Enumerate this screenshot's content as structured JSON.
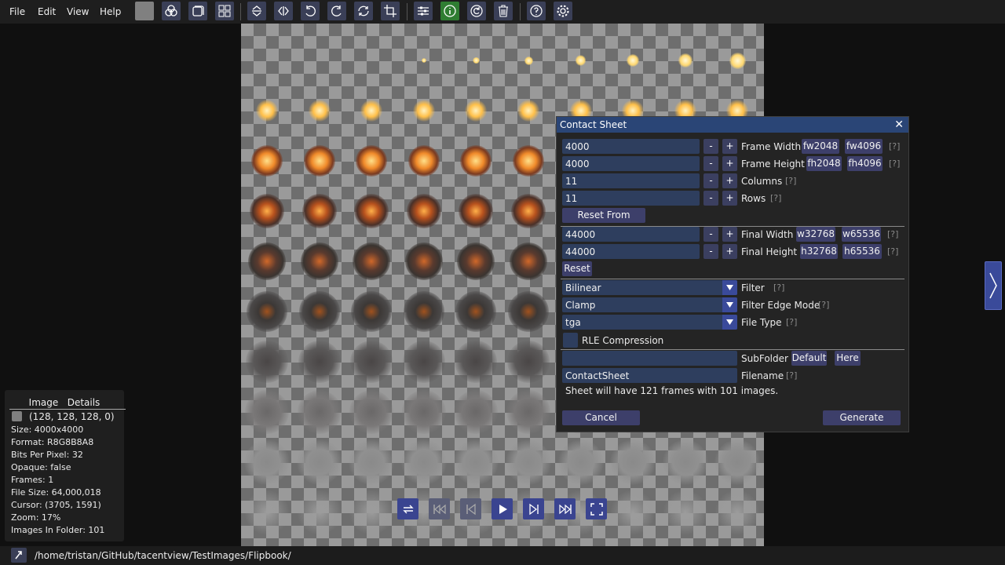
{
  "menu": {
    "file": "File",
    "edit": "Edit",
    "view": "View",
    "help": "Help"
  },
  "toolbar_icons": [
    "color-swatch-icon",
    "channels-icon",
    "tile-icon",
    "contact-sheet-icon",
    "flip-vertical-icon",
    "flip-horizontal-icon",
    "rotate-left-icon",
    "rotate-right-icon",
    "rotate-anti-icon",
    "crop-icon",
    "adjust-icon",
    "info-icon",
    "refresh-icon",
    "delete-icon",
    "help-icon",
    "settings-icon"
  ],
  "details": {
    "header": "Image   Details",
    "color_text": "(128, 128, 128, 0)",
    "size": "Size: 4000x4000",
    "format": "Format: R8G8B8A8",
    "bpp": "Bits Per Pixel: 32",
    "opaque": "Opaque: false",
    "frames": "Frames: 1",
    "file_size": "File Size: 64,000,018",
    "cursor": "Cursor: (3705, 1591)",
    "zoom": "Zoom: 17%",
    "images_in_folder": "Images In Folder: 101"
  },
  "status": {
    "path": "/home/tristan/GitHub/tacentview/TestImages/Flipbook/"
  },
  "dialog": {
    "title": "Contact Sheet",
    "frame_width": {
      "value": "4000",
      "label": "Frame Width",
      "chip1": "fw2048",
      "chip2": "fw4096"
    },
    "frame_height": {
      "value": "4000",
      "label": "Frame Height",
      "chip1": "fh2048",
      "chip2": "fh4096"
    },
    "columns": {
      "value": "11",
      "label": "Columns"
    },
    "rows": {
      "value": "11",
      "label": "Rows"
    },
    "reset_from_image": "Reset From Image",
    "final_width": {
      "value": "44000",
      "label": "Final Width",
      "chip1": "w32768",
      "chip2": "w65536"
    },
    "final_height": {
      "value": "44000",
      "label": "Final Height",
      "chip1": "h32768",
      "chip2": "h65536"
    },
    "reset": "Reset",
    "filter": {
      "value": "Bilinear",
      "label": "Filter"
    },
    "edge_mode": {
      "value": "Clamp",
      "label": "Filter Edge Mode"
    },
    "file_type": {
      "value": "tga",
      "label": "File Type"
    },
    "rle": {
      "label": "RLE Compression",
      "checked": false
    },
    "subfolder": {
      "value": "",
      "label": "SubFolder",
      "default_btn": "Default",
      "here_btn": "Here"
    },
    "filename": {
      "value": "ContactSheet",
      "label": "Filename"
    },
    "info": "Sheet will have 121 frames with 101 images.",
    "cancel": "Cancel",
    "generate": "Generate",
    "minus": "-",
    "plus": "+",
    "help_mark": "[?]"
  },
  "colors": {
    "accent": "#3a4490",
    "dialog_title": "#2a4576",
    "field_bg": "#2e3e5e"
  }
}
